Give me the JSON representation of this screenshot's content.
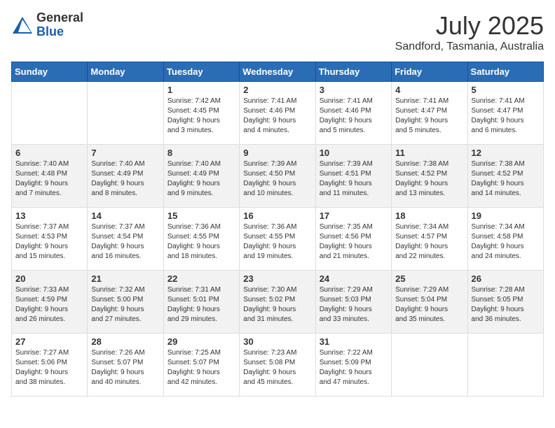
{
  "header": {
    "logo_general": "General",
    "logo_blue": "Blue",
    "month_year": "July 2025",
    "location": "Sandford, Tasmania, Australia"
  },
  "days_of_week": [
    "Sunday",
    "Monday",
    "Tuesday",
    "Wednesday",
    "Thursday",
    "Friday",
    "Saturday"
  ],
  "weeks": [
    [
      {
        "day": "",
        "detail": ""
      },
      {
        "day": "",
        "detail": ""
      },
      {
        "day": "1",
        "detail": "Sunrise: 7:42 AM\nSunset: 4:45 PM\nDaylight: 9 hours\nand 3 minutes."
      },
      {
        "day": "2",
        "detail": "Sunrise: 7:41 AM\nSunset: 4:46 PM\nDaylight: 9 hours\nand 4 minutes."
      },
      {
        "day": "3",
        "detail": "Sunrise: 7:41 AM\nSunset: 4:46 PM\nDaylight: 9 hours\nand 5 minutes."
      },
      {
        "day": "4",
        "detail": "Sunrise: 7:41 AM\nSunset: 4:47 PM\nDaylight: 9 hours\nand 5 minutes."
      },
      {
        "day": "5",
        "detail": "Sunrise: 7:41 AM\nSunset: 4:47 PM\nDaylight: 9 hours\nand 6 minutes."
      }
    ],
    [
      {
        "day": "6",
        "detail": "Sunrise: 7:40 AM\nSunset: 4:48 PM\nDaylight: 9 hours\nand 7 minutes."
      },
      {
        "day": "7",
        "detail": "Sunrise: 7:40 AM\nSunset: 4:49 PM\nDaylight: 9 hours\nand 8 minutes."
      },
      {
        "day": "8",
        "detail": "Sunrise: 7:40 AM\nSunset: 4:49 PM\nDaylight: 9 hours\nand 9 minutes."
      },
      {
        "day": "9",
        "detail": "Sunrise: 7:39 AM\nSunset: 4:50 PM\nDaylight: 9 hours\nand 10 minutes."
      },
      {
        "day": "10",
        "detail": "Sunrise: 7:39 AM\nSunset: 4:51 PM\nDaylight: 9 hours\nand 11 minutes."
      },
      {
        "day": "11",
        "detail": "Sunrise: 7:38 AM\nSunset: 4:52 PM\nDaylight: 9 hours\nand 13 minutes."
      },
      {
        "day": "12",
        "detail": "Sunrise: 7:38 AM\nSunset: 4:52 PM\nDaylight: 9 hours\nand 14 minutes."
      }
    ],
    [
      {
        "day": "13",
        "detail": "Sunrise: 7:37 AM\nSunset: 4:53 PM\nDaylight: 9 hours\nand 15 minutes."
      },
      {
        "day": "14",
        "detail": "Sunrise: 7:37 AM\nSunset: 4:54 PM\nDaylight: 9 hours\nand 16 minutes."
      },
      {
        "day": "15",
        "detail": "Sunrise: 7:36 AM\nSunset: 4:55 PM\nDaylight: 9 hours\nand 18 minutes."
      },
      {
        "day": "16",
        "detail": "Sunrise: 7:36 AM\nSunset: 4:55 PM\nDaylight: 9 hours\nand 19 minutes."
      },
      {
        "day": "17",
        "detail": "Sunrise: 7:35 AM\nSunset: 4:56 PM\nDaylight: 9 hours\nand 21 minutes."
      },
      {
        "day": "18",
        "detail": "Sunrise: 7:34 AM\nSunset: 4:57 PM\nDaylight: 9 hours\nand 22 minutes."
      },
      {
        "day": "19",
        "detail": "Sunrise: 7:34 AM\nSunset: 4:58 PM\nDaylight: 9 hours\nand 24 minutes."
      }
    ],
    [
      {
        "day": "20",
        "detail": "Sunrise: 7:33 AM\nSunset: 4:59 PM\nDaylight: 9 hours\nand 26 minutes."
      },
      {
        "day": "21",
        "detail": "Sunrise: 7:32 AM\nSunset: 5:00 PM\nDaylight: 9 hours\nand 27 minutes."
      },
      {
        "day": "22",
        "detail": "Sunrise: 7:31 AM\nSunset: 5:01 PM\nDaylight: 9 hours\nand 29 minutes."
      },
      {
        "day": "23",
        "detail": "Sunrise: 7:30 AM\nSunset: 5:02 PM\nDaylight: 9 hours\nand 31 minutes."
      },
      {
        "day": "24",
        "detail": "Sunrise: 7:29 AM\nSunset: 5:03 PM\nDaylight: 9 hours\nand 33 minutes."
      },
      {
        "day": "25",
        "detail": "Sunrise: 7:29 AM\nSunset: 5:04 PM\nDaylight: 9 hours\nand 35 minutes."
      },
      {
        "day": "26",
        "detail": "Sunrise: 7:28 AM\nSunset: 5:05 PM\nDaylight: 9 hours\nand 36 minutes."
      }
    ],
    [
      {
        "day": "27",
        "detail": "Sunrise: 7:27 AM\nSunset: 5:06 PM\nDaylight: 9 hours\nand 38 minutes."
      },
      {
        "day": "28",
        "detail": "Sunrise: 7:26 AM\nSunset: 5:07 PM\nDaylight: 9 hours\nand 40 minutes."
      },
      {
        "day": "29",
        "detail": "Sunrise: 7:25 AM\nSunset: 5:07 PM\nDaylight: 9 hours\nand 42 minutes."
      },
      {
        "day": "30",
        "detail": "Sunrise: 7:23 AM\nSunset: 5:08 PM\nDaylight: 9 hours\nand 45 minutes."
      },
      {
        "day": "31",
        "detail": "Sunrise: 7:22 AM\nSunset: 5:09 PM\nDaylight: 9 hours\nand 47 minutes."
      },
      {
        "day": "",
        "detail": ""
      },
      {
        "day": "",
        "detail": ""
      }
    ]
  ]
}
